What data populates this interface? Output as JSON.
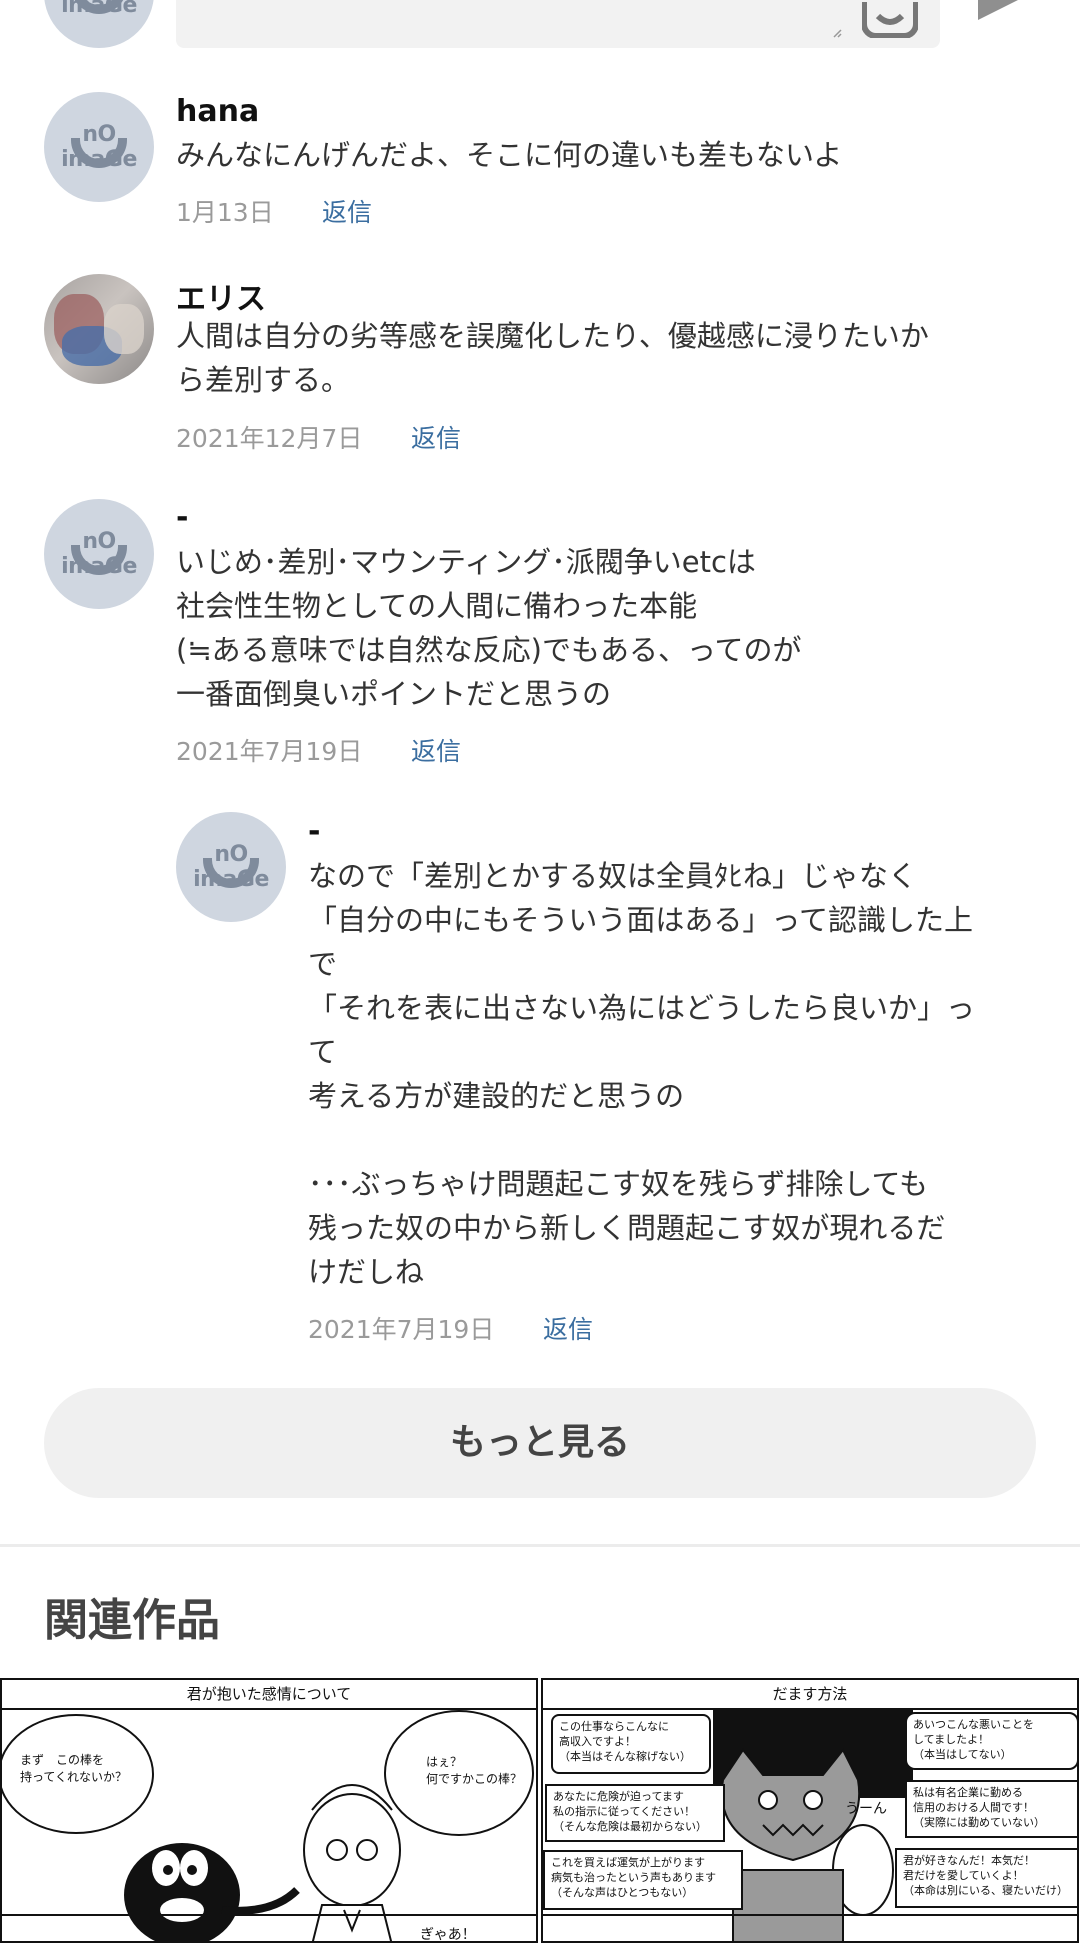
{
  "comments": [
    {
      "name": "hana",
      "body": "みんなにんげんだよ、そこに何の違いも差もないよ",
      "date": "1月13日",
      "reply": "返信"
    },
    {
      "name": "エリス",
      "body": "人間は自分の劣等感を誤魔化したり、優越感に浸りたいか\nら差別する。",
      "date": "2021年12月7日",
      "reply": "返信"
    },
    {
      "name": "-",
      "body": "いじめ･差別･マウンティング･派閥争いetcは\n社会性生物としての人間に備わった本能\n(≒ある意味では自然な反応)でもある、ってのが\n一番面倒臭いポイントだと思うの",
      "date": "2021年7月19日",
      "reply": "返信"
    },
    {
      "name": "-",
      "body": "なので「差別とかする奴は全員ﾀﾋね」じゃなく\n「自分の中にもそういう面はある」って認識した上\nで\n「それを表に出さない為にはどうしたら良いか」っ\nて\n考える方が建設的だと思うの\n\n･･･ぶっちゃけ問題起こす奴を残らず排除しても\n残った奴の中から新しく問題起こす奴が現れるだ\nけだしね",
      "date": "2021年7月19日",
      "reply": "返信"
    }
  ],
  "avatar_text": "nO imaGe",
  "more_label": "もっと見る",
  "related_title": "関連作品",
  "related": [
    {
      "title": "君が抱いた感情について",
      "bubble_left": "まず　この棒を\n持ってくれないか？",
      "bubble_right": "はぇ？\n何ですかこの棒？"
    },
    {
      "title": "だます方法",
      "boxes": [
        "この仕事ならこんなに\n高収入ですよ！\n（本当はそんな稼げない）",
        "あなたに危険が迫ってます\n私の指示に従ってください！\n（そんな危険は最初からない）",
        "これを買えば運気が上がります\n病気も治ったという声もあります\n（そんな声はひとつもない）",
        "あいつこんな悪いことを\nしてましたよ！\n（本当はしてない）",
        "私は有名企業に勤める\n信用のおける人間です！\n（実際には勤めていない）",
        "君が好きなんだ！本気だ！\n君だけを愛していくよ！\n（本命は別にいる、寝たいだけ）"
      ],
      "sfx": "うーん"
    }
  ],
  "partial_text": "ぎゃあ！"
}
